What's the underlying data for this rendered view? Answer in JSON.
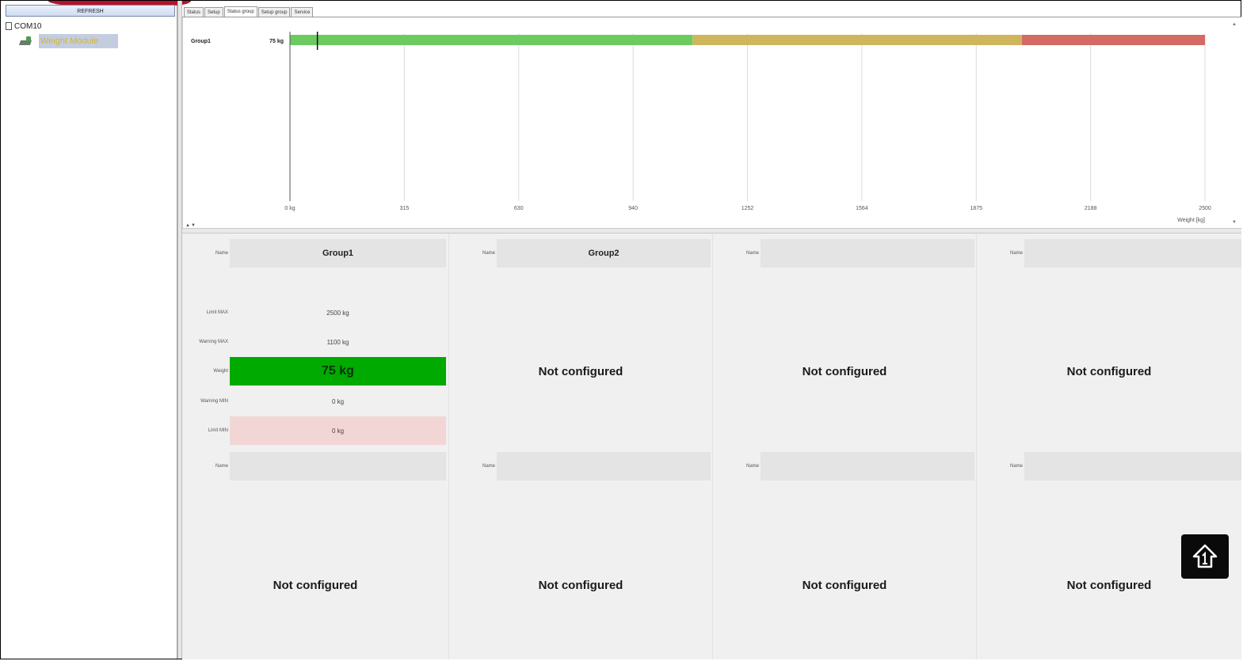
{
  "left_pane": {
    "refresh_label": "REFRESH",
    "tree_root": "COM10",
    "tree_child": "Weight Module"
  },
  "tabs": [
    {
      "label": "Status"
    },
    {
      "label": "Setup"
    },
    {
      "label": "Status group",
      "active": true
    },
    {
      "label": "Setup group"
    },
    {
      "label": "Service"
    }
  ],
  "chart_data": {
    "type": "bar",
    "orientation": "horizontal",
    "categories": [
      "Group1"
    ],
    "values": [
      75
    ],
    "value_label": "75 kg",
    "xlabel": "Weight [kg]",
    "xlim": [
      0,
      2500
    ],
    "x_ticks": [
      "0 kg",
      "315",
      "630",
      "940",
      "1252",
      "1564",
      "1875",
      "2188",
      "2500"
    ],
    "x_tick_values": [
      0,
      312.5,
      625,
      937.5,
      1250,
      1562.5,
      1875,
      2187.5,
      2500
    ],
    "zones": [
      {
        "from": 0,
        "to": 1100,
        "color": "#6bcb5f"
      },
      {
        "from": 1100,
        "to": 2000,
        "color": "#cfb55b"
      },
      {
        "from": 2000,
        "to": 2500,
        "color": "#d36a64"
      }
    ],
    "grid": true
  },
  "groups": [
    {
      "name_label": "Name",
      "name": "Group1",
      "limit_max_label": "Limit MAX",
      "limit_max": "2500 kg",
      "warning_max_label": "Warning MAX",
      "warning_max": "1100 kg",
      "weight_label": "Weight",
      "weight": "75 kg",
      "warning_min_label": "Warning MIN",
      "warning_min": "0 kg",
      "limit_min_label": "Limit MIN",
      "limit_min": "0 kg"
    },
    {
      "name_label": "Name",
      "name": "Group2",
      "status": "Not configured"
    },
    {
      "name_label": "Name",
      "name": "",
      "status": "Not configured"
    },
    {
      "name_label": "Name",
      "name": "",
      "status": "Not configured"
    },
    {
      "name_label": "Name",
      "name": "",
      "status": "Not configured"
    },
    {
      "name_label": "Name",
      "name": "",
      "status": "Not configured"
    },
    {
      "name_label": "Name",
      "name": "",
      "status": "Not configured"
    },
    {
      "name_label": "Name",
      "name": "",
      "status": "Not configured"
    }
  ],
  "icons": {
    "home": "home-up-icon",
    "page": "page-icon",
    "device": "device-icon"
  },
  "colors": {
    "weight_ok": "#00aa00",
    "limit_min_bg": "#f2d6d6",
    "tree_selected_bg": "#c3cde0"
  }
}
